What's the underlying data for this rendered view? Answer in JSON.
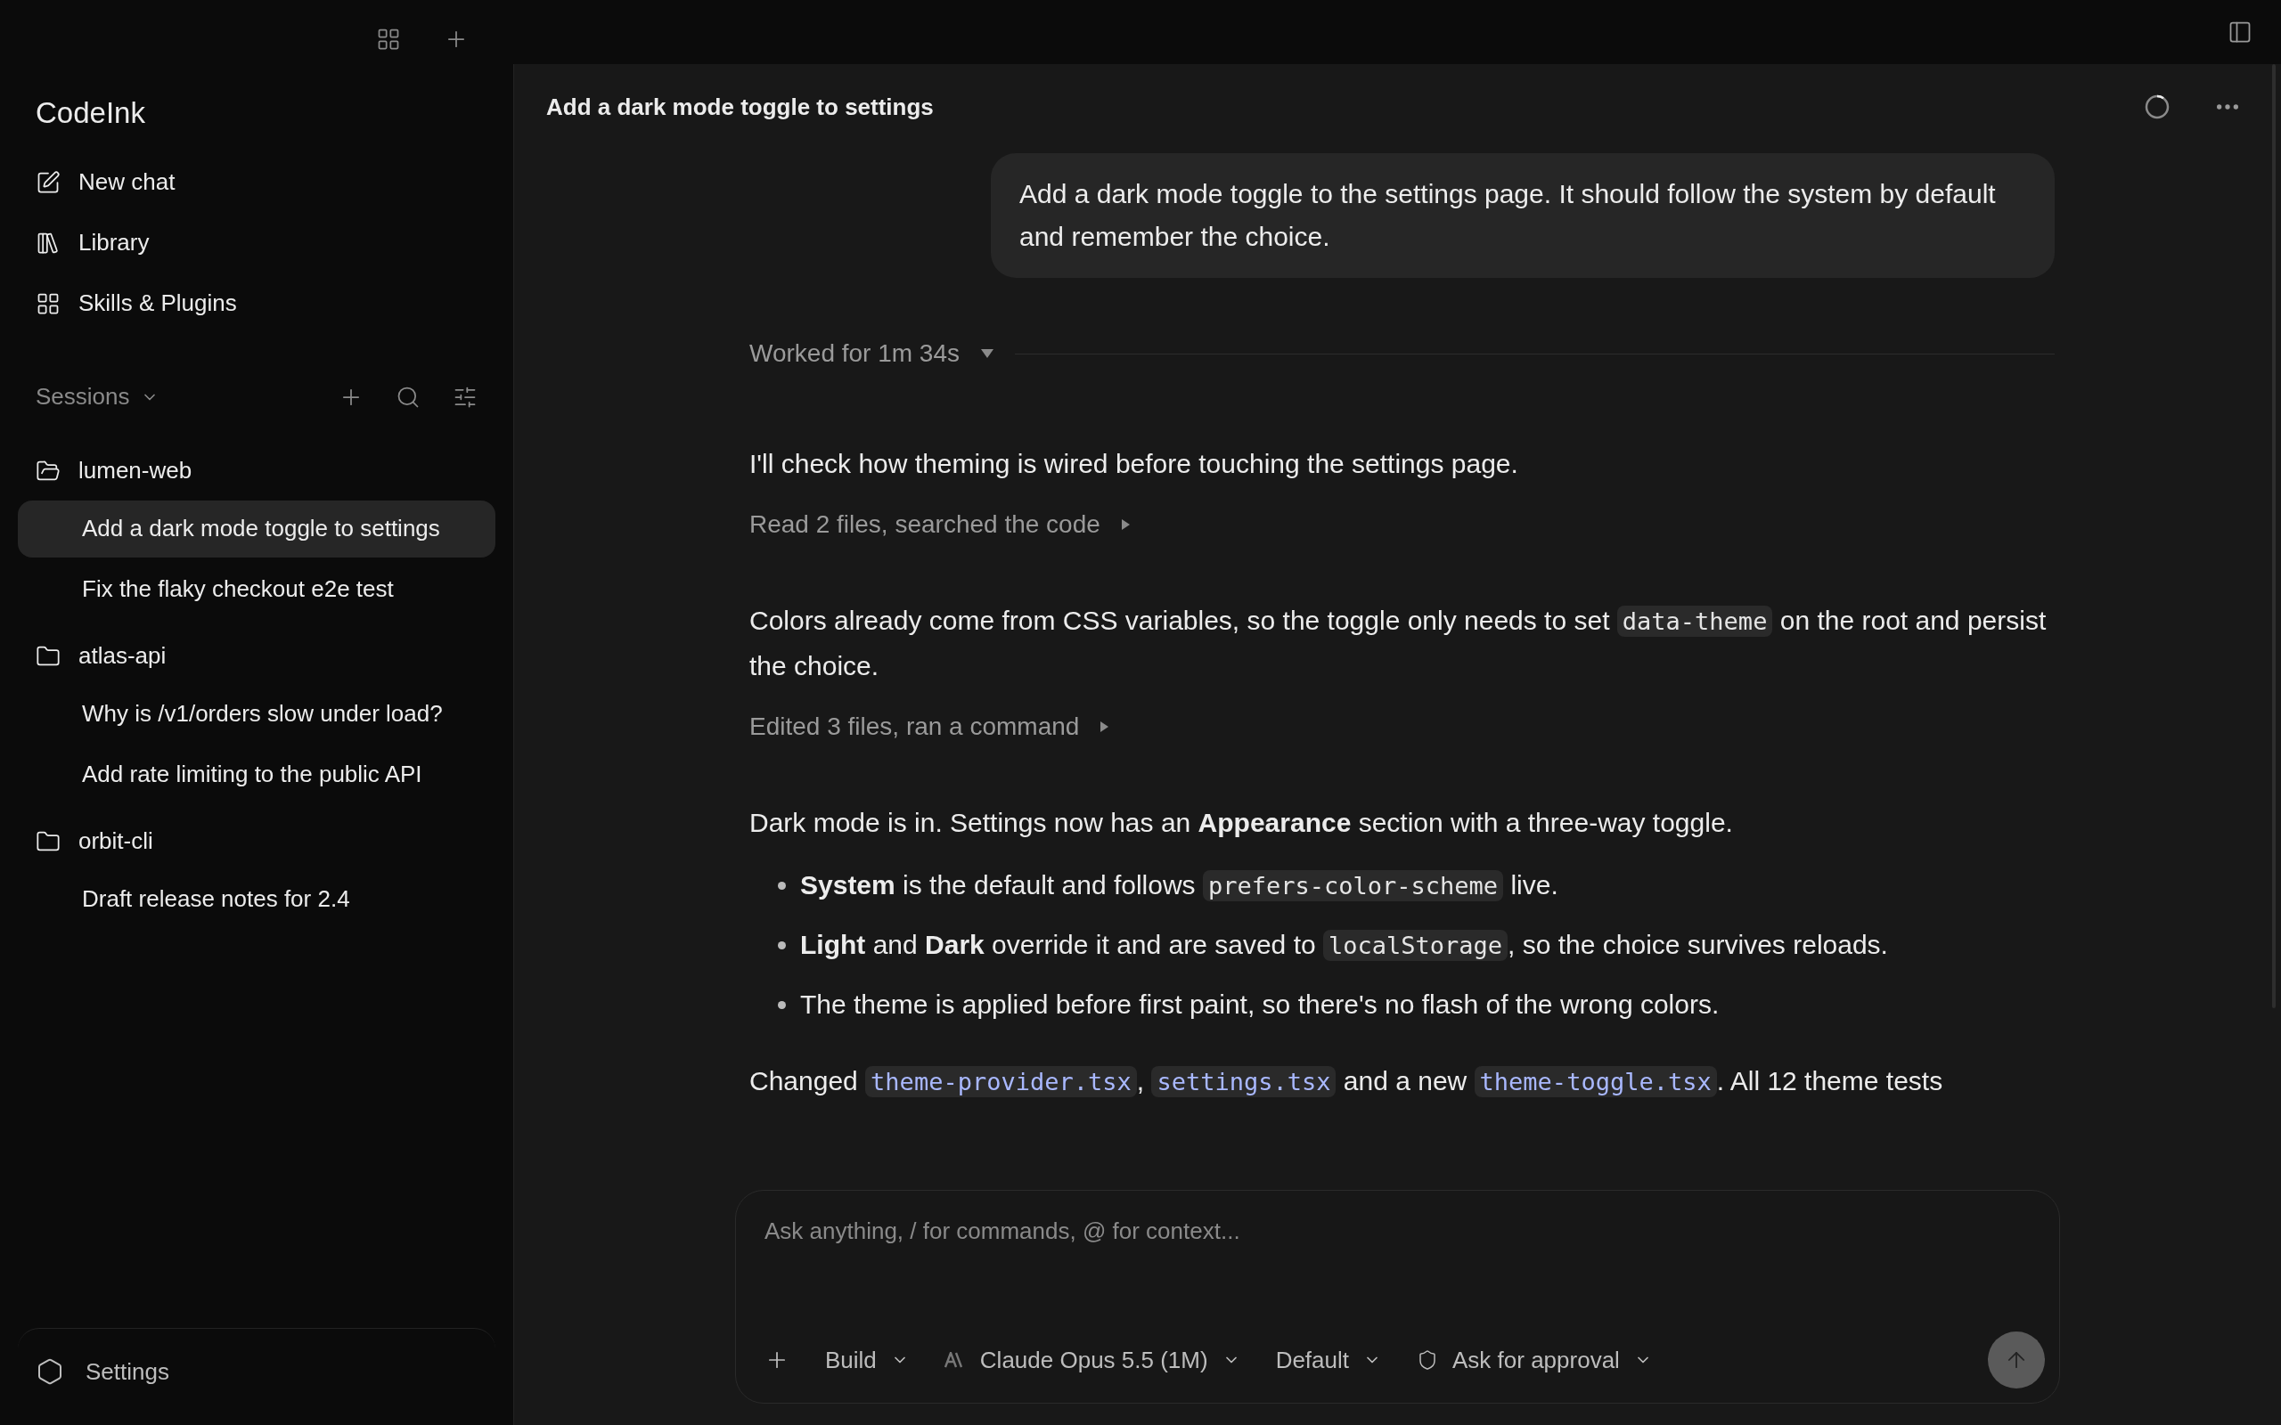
{
  "app": {
    "name": "CodeInk"
  },
  "nav": [
    {
      "label": "New chat",
      "kind": "compose"
    },
    {
      "label": "Library",
      "kind": "library"
    },
    {
      "label": "Skills & Plugins",
      "kind": "plugins"
    }
  ],
  "sessions": {
    "label": "Sessions",
    "groups": [
      {
        "name": "lumen-web",
        "items": [
          {
            "title": "Add a dark mode toggle to settings",
            "selected": true
          },
          {
            "title": "Fix the flaky checkout e2e test",
            "selected": false
          }
        ]
      },
      {
        "name": "atlas-api",
        "items": [
          {
            "title": "Why is /v1/orders slow under load?",
            "selected": false
          },
          {
            "title": "Add rate limiting to the public API",
            "selected": false
          }
        ]
      },
      {
        "name": "orbit-cli",
        "items": [
          {
            "title": "Draft release notes for 2.4",
            "selected": false
          }
        ]
      }
    ]
  },
  "settings": {
    "label": "Settings"
  },
  "chat": {
    "title": "Add a dark mode toggle to settings",
    "user_message": "Add a dark mode toggle to the settings page. It should follow the system by default and remember the choice.",
    "worked": "Worked for 1m 34s",
    "blocks": [
      {
        "kind": "paragraph",
        "segments": [
          {
            "kind": "text",
            "text": "I'll check how theming is wired before touching the settings page."
          }
        ]
      },
      {
        "kind": "activity",
        "text": "Read 2 files, searched the code"
      },
      {
        "kind": "paragraph",
        "segments": [
          {
            "kind": "text",
            "text": "Colors already come from CSS variables, so the toggle only needs to set "
          },
          {
            "kind": "code",
            "text": "data-theme"
          },
          {
            "kind": "text",
            "text": " on the root and persist the choice."
          }
        ]
      },
      {
        "kind": "activity",
        "text": "Edited 3 files, ran a command"
      },
      {
        "kind": "paragraph",
        "segments": [
          {
            "kind": "text",
            "text": "Dark mode is in. Settings now has an **Appearance** section with a three-way toggle."
          }
        ]
      },
      {
        "kind": "bullet",
        "segments": [
          {
            "kind": "text",
            "text": "**System** is the default and follows "
          },
          {
            "kind": "code",
            "text": "prefers-color-scheme"
          },
          {
            "kind": "text",
            "text": " live."
          }
        ]
      },
      {
        "kind": "bullet",
        "segments": [
          {
            "kind": "text",
            "text": "**Light** and **Dark** override it and are saved to "
          },
          {
            "kind": "code",
            "text": "localStorage"
          },
          {
            "kind": "text",
            "text": ", so the choice survives reloads."
          }
        ]
      },
      {
        "kind": "bullet",
        "segments": [
          {
            "kind": "text",
            "text": "The theme is applied before first paint, so there's no flash of the wrong colors."
          }
        ]
      },
      {
        "kind": "paragraph",
        "segments": [
          {
            "kind": "text",
            "text": "Changed "
          },
          {
            "kind": "file",
            "text": "theme-provider.tsx"
          },
          {
            "kind": "text",
            "text": ", "
          },
          {
            "kind": "file",
            "text": "settings.tsx"
          },
          {
            "kind": "text",
            "text": " and a new "
          },
          {
            "kind": "file",
            "text": "theme-toggle.tsx"
          },
          {
            "kind": "text",
            "text": ". All 12 theme tests"
          }
        ]
      }
    ]
  },
  "composer": {
    "placeholder": "Ask anything, / for commands, @ for context...",
    "mode": "Build",
    "model": "Claude Opus 5.5 (1M)",
    "profile": "Default",
    "approval": "Ask for approval"
  }
}
